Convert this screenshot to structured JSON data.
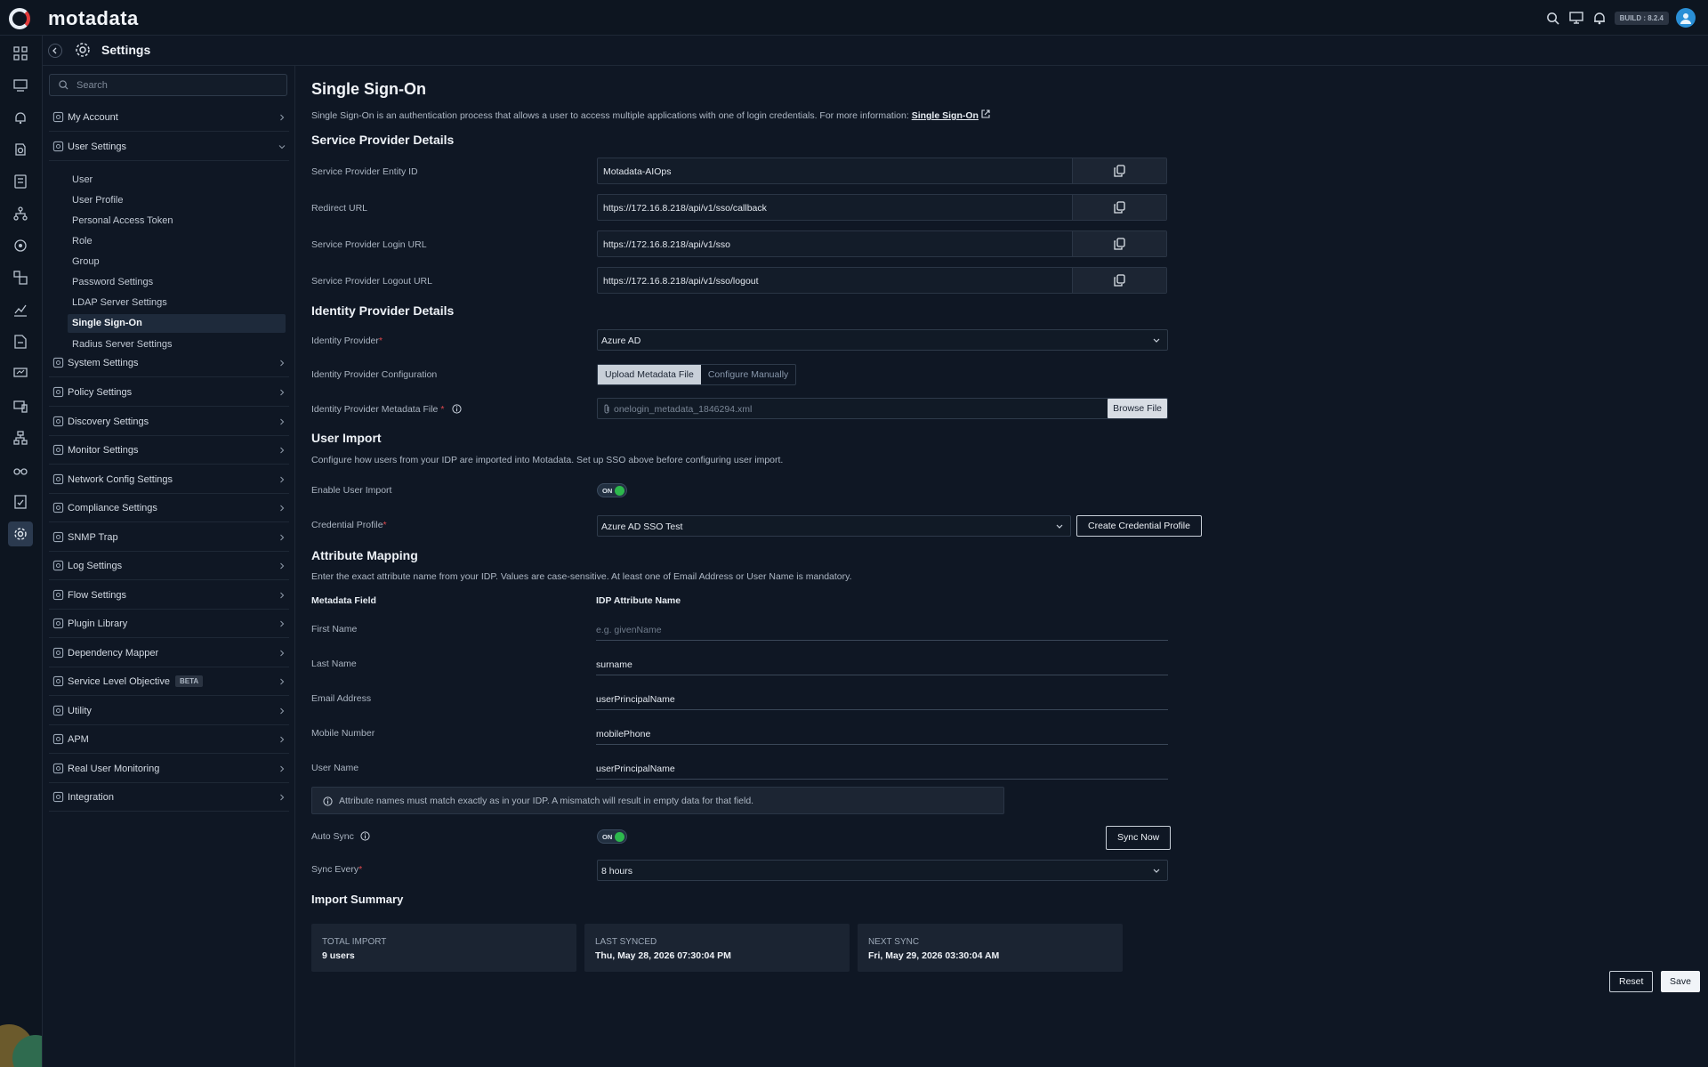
{
  "app": {
    "brand": "motadata",
    "build": "BUILD : 8.2.4"
  },
  "header": {
    "title": "Settings"
  },
  "sidebar": {
    "search_placeholder": "Search",
    "items": [
      {
        "label": "My Account",
        "icon": "user-icon"
      },
      {
        "label": "User Settings",
        "icon": "user-gear-icon",
        "expanded": true
      },
      {
        "label": "System Settings",
        "icon": "system-icon"
      },
      {
        "label": "Policy Settings",
        "icon": "sliders-icon"
      },
      {
        "label": "Discovery Settings",
        "icon": "discovery-icon"
      },
      {
        "label": "Monitor Settings",
        "icon": "monitor-icon"
      },
      {
        "label": "Network Config Settings",
        "icon": "network-config-icon"
      },
      {
        "label": "Compliance Settings",
        "icon": "chart-line-icon"
      },
      {
        "label": "SNMP Trap",
        "icon": "binoculars-icon"
      },
      {
        "label": "Log Settings",
        "icon": "log-icon"
      },
      {
        "label": "Flow Settings",
        "icon": "flow-icon"
      },
      {
        "label": "Plugin Library",
        "icon": "cloud-icon"
      },
      {
        "label": "Dependency Mapper",
        "icon": "dependency-icon"
      },
      {
        "label": "Service Level Objective",
        "icon": "target-icon",
        "badge": "BETA"
      },
      {
        "label": "Utility",
        "icon": "gear-icon"
      },
      {
        "label": "APM",
        "icon": "apm-icon"
      },
      {
        "label": "Real User Monitoring",
        "icon": "rum-icon"
      },
      {
        "label": "Integration",
        "icon": "plug-icon"
      }
    ],
    "sub_items": [
      "User",
      "User Profile",
      "Personal Access Token",
      "Role",
      "Group",
      "Password Settings",
      "LDAP Server Settings",
      "Single Sign-On",
      "Radius Server Settings"
    ],
    "active_sub": "Single Sign-On"
  },
  "page": {
    "title": "Single Sign-On",
    "description": "Single Sign-On is an authentication process that allows a user to access multiple applications with one of login credentials. For more information:",
    "description_link": "Single Sign-On",
    "service_provider": {
      "heading": "Service Provider Details",
      "fields": [
        {
          "label": "Service Provider Entity ID",
          "value": "Motadata-AIOps"
        },
        {
          "label": "Redirect URL",
          "value": "https://172.16.8.218/api/v1/sso/callback"
        },
        {
          "label": "Service Provider Login URL",
          "value": "https://172.16.8.218/api/v1/sso"
        },
        {
          "label": "Service Provider Logout URL",
          "value": "https://172.16.8.218/api/v1/sso/logout"
        }
      ]
    },
    "identity_provider": {
      "heading": "Identity Provider Details",
      "provider_label": "Identity Provider",
      "provider_value": "Azure AD",
      "config_label": "Identity Provider Configuration",
      "config_options": [
        "Upload Metadata File",
        "Configure Manually"
      ],
      "metadata_label": "Identity Provider Metadata File",
      "metadata_value": "onelogin_metadata_1846294.xml",
      "browse_label": "Browse File"
    },
    "user_import": {
      "heading": "User Import",
      "description": "Configure how users from your IDP are imported into Motadata. Set up SSO above before configuring user import.",
      "enable_label": "Enable User Import",
      "enable_state": "ON",
      "credential_label": "Credential Profile",
      "credential_value": "Azure AD SSO Test",
      "create_credential_label": "Create Credential Profile"
    },
    "attribute_mapping": {
      "heading": "Attribute Mapping",
      "description": "Enter the exact attribute name from your IDP. Values are case-sensitive. At least one of Email Address or User Name is mandatory.",
      "col_field": "Metadata Field",
      "col_attr": "IDP Attribute Name",
      "rows": [
        {
          "field": "First Name",
          "value": "",
          "placeholder": "e.g. givenName"
        },
        {
          "field": "Last Name",
          "value": "surname"
        },
        {
          "field": "Email Address",
          "value": "userPrincipalName"
        },
        {
          "field": "Mobile Number",
          "value": "mobilePhone"
        },
        {
          "field": "User Name",
          "value": "userPrincipalName"
        }
      ],
      "info": "Attribute names must match exactly as in your IDP. A mismatch will result in empty data for that field."
    },
    "sync": {
      "auto_label": "Auto Sync",
      "auto_state": "ON",
      "sync_now_label": "Sync Now",
      "every_label": "Sync Every",
      "every_value": "8 hours"
    },
    "summary": {
      "heading": "Import Summary",
      "cards": [
        {
          "title": "TOTAL IMPORT",
          "value": "9 users"
        },
        {
          "title": "LAST SYNCED",
          "value": "Thu, May 28, 2026 07:30:04 PM"
        },
        {
          "title": "NEXT SYNC",
          "value": "Fri, May 29, 2026 03:30:04 AM"
        }
      ]
    },
    "actions": {
      "reset": "Reset",
      "save": "Save"
    }
  },
  "colors": {
    "background": "#0f1724",
    "accent_on": "#2db84d",
    "required": "#e0484d",
    "logo_red": "#e23b3b"
  }
}
